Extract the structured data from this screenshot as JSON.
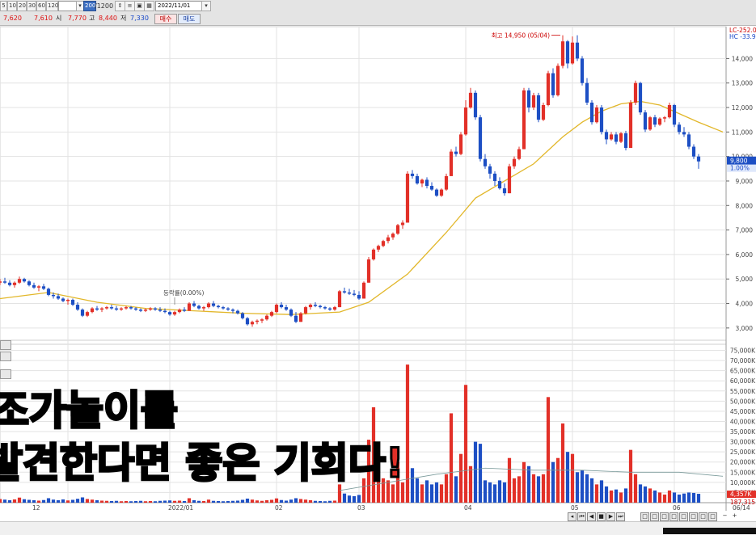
{
  "toolbar": {
    "periods": [
      "5",
      "10",
      "20",
      "30",
      "60",
      "120"
    ],
    "period_input": "",
    "count_selected": "200",
    "count_total": "/1200",
    "date": "2022/11/01"
  },
  "quote": {
    "current": "7,620",
    "change": "7,610",
    "open_label": "시",
    "open": "7,770",
    "high_label": "고",
    "high": "8,440",
    "low_label": "저",
    "low": "7,330",
    "buy_label": "매수",
    "sell_label": "매도"
  },
  "annotations": {
    "high_marker": "최고 14,950 (05/04)",
    "limit_marker": "등락률(0.00%)",
    "lc": "LC-252.0",
    "hc": "HC -33.9",
    "current_price_badge": "9,800",
    "current_pct_badge": "1.00%",
    "volume_badge": "4,357K",
    "volume_ma_badge": "187,315"
  },
  "date_labels": [
    "12",
    "2022/01",
    "02",
    "03",
    "04",
    "05",
    "06",
    "06/14"
  ],
  "overlay_text": {
    "line1_red": "조",
    "line1_white": "가놀이를",
    "line2_white": "발견한다면 ",
    "line2_red": "좋은 기회다!"
  },
  "colors": {
    "up": "#e23028",
    "down": "#1d4fc4",
    "ma": "#e2b72a",
    "grid": "#e3e3e3"
  },
  "chart_data": {
    "type": "candlestick",
    "price_axis": {
      "ticks": [
        3000,
        4000,
        5000,
        6000,
        7000,
        8000,
        9000,
        10000,
        11000,
        12000,
        13000,
        14000
      ],
      "tick_labels": [
        "3,000",
        "4,000",
        "5,000",
        "6,000",
        "7,000",
        "8,000",
        "9,000",
        "10,000",
        "11,000",
        "12,000",
        "13,000",
        "14,000"
      ],
      "ylim": [
        2500,
        15300
      ]
    },
    "volume_axis": {
      "ticks": [
        5000,
        10000,
        15000,
        20000,
        25000,
        30000,
        35000,
        40000,
        45000,
        50000,
        55000,
        60000,
        65000,
        70000,
        75000
      ],
      "tick_labels": [
        "5,000K",
        "10,000K",
        "15,000K",
        "20,000K",
        "25,000K",
        "30,000K",
        "35,000K",
        "40,000K",
        "45,000K",
        "50,000K",
        "55,000K",
        "60,000K",
        "65,000K",
        "70,000K",
        "75,000K"
      ],
      "ylim": [
        0,
        78000
      ]
    },
    "candles": [
      [
        4850,
        5000,
        4750,
        4900,
        1800
      ],
      [
        4900,
        5050,
        4800,
        4850,
        1500
      ],
      [
        4850,
        4950,
        4700,
        4750,
        1200
      ],
      [
        4750,
        4900,
        4650,
        4850,
        1600
      ],
      [
        4850,
        5100,
        4800,
        5000,
        2500
      ],
      [
        5000,
        5050,
        4850,
        4900,
        1700
      ],
      [
        4900,
        4950,
        4700,
        4750,
        1400
      ],
      [
        4750,
        4850,
        4600,
        4650,
        1200
      ],
      [
        4650,
        4750,
        4500,
        4700,
        1000
      ],
      [
        4700,
        4800,
        4550,
        4600,
        1300
      ],
      [
        4600,
        4650,
        4300,
        4350,
        2200
      ],
      [
        4350,
        4450,
        4200,
        4300,
        1500
      ],
      [
        4300,
        4400,
        4150,
        4200,
        1200
      ],
      [
        4200,
        4250,
        4050,
        4100,
        1600
      ],
      [
        4100,
        4200,
        3950,
        4150,
        1100
      ],
      [
        4150,
        4200,
        3900,
        3950,
        1400
      ],
      [
        3950,
        4050,
        3700,
        3750,
        1900
      ],
      [
        3750,
        3800,
        3450,
        3500,
        2600
      ],
      [
        3500,
        3700,
        3450,
        3650,
        1800
      ],
      [
        3650,
        3850,
        3600,
        3800,
        1500
      ],
      [
        3800,
        3900,
        3700,
        3750,
        1200
      ],
      [
        3750,
        3850,
        3650,
        3800,
        1000
      ],
      [
        3800,
        3900,
        3750,
        3850,
        900
      ],
      [
        3850,
        3950,
        3750,
        3800,
        800
      ],
      [
        3800,
        3900,
        3700,
        3750,
        900
      ],
      [
        3750,
        3850,
        3700,
        3800,
        700
      ],
      [
        3800,
        3900,
        3750,
        3850,
        800
      ],
      [
        3850,
        3900,
        3750,
        3800,
        700
      ],
      [
        3800,
        3850,
        3700,
        3750,
        800
      ],
      [
        3750,
        3800,
        3650,
        3700,
        900
      ],
      [
        3700,
        3800,
        3650,
        3750,
        700
      ],
      [
        3750,
        3850,
        3700,
        3800,
        800
      ],
      [
        3800,
        3850,
        3700,
        3750,
        700
      ],
      [
        3750,
        3850,
        3650,
        3700,
        900
      ],
      [
        3700,
        3800,
        3600,
        3650,
        1000
      ],
      [
        3650,
        3700,
        3500,
        3550,
        1100
      ],
      [
        3550,
        3700,
        3500,
        3650,
        900
      ],
      [
        3650,
        3800,
        3600,
        3750,
        1000
      ],
      [
        3750,
        3850,
        3650,
        3700,
        800
      ],
      [
        3700,
        4050,
        3700,
        4000,
        2200
      ],
      [
        4000,
        4100,
        3850,
        3900,
        1200
      ],
      [
        3900,
        3950,
        3750,
        3800,
        900
      ],
      [
        3800,
        3900,
        3700,
        3850,
        800
      ],
      [
        3850,
        4050,
        3800,
        4000,
        1500
      ],
      [
        4000,
        4100,
        3850,
        3900,
        900
      ],
      [
        3900,
        3950,
        3800,
        3850,
        800
      ],
      [
        3850,
        3900,
        3750,
        3800,
        700
      ],
      [
        3800,
        3850,
        3700,
        3750,
        800
      ],
      [
        3750,
        3800,
        3600,
        3700,
        900
      ],
      [
        3700,
        3750,
        3550,
        3600,
        1000
      ],
      [
        3600,
        3650,
        3350,
        3400,
        1400
      ],
      [
        3400,
        3450,
        3100,
        3150,
        2000
      ],
      [
        3150,
        3300,
        3050,
        3250,
        1500
      ],
      [
        3250,
        3350,
        3150,
        3300,
        1100
      ],
      [
        3300,
        3400,
        3200,
        3350,
        900
      ],
      [
        3350,
        3550,
        3300,
        3500,
        1200
      ],
      [
        3500,
        3700,
        3450,
        3650,
        1400
      ],
      [
        3650,
        4000,
        3600,
        3950,
        2100
      ],
      [
        3950,
        4050,
        3800,
        3850,
        1300
      ],
      [
        3850,
        3950,
        3700,
        3750,
        1000
      ],
      [
        3750,
        3800,
        3450,
        3500,
        1500
      ],
      [
        3500,
        3650,
        3200,
        3250,
        2200
      ],
      [
        3250,
        3650,
        3250,
        3600,
        1800
      ],
      [
        3600,
        3900,
        3550,
        3850,
        1500
      ],
      [
        3850,
        4000,
        3750,
        3950,
        1200
      ],
      [
        3950,
        4050,
        3850,
        3900,
        900
      ],
      [
        3900,
        3950,
        3800,
        3850,
        800
      ],
      [
        3850,
        3900,
        3750,
        3800,
        700
      ],
      [
        3800,
        3850,
        3700,
        3750,
        900
      ],
      [
        3750,
        3900,
        3700,
        3850,
        1000
      ],
      [
        3850,
        4550,
        3850,
        4500,
        9000
      ],
      [
        4500,
        4650,
        4400,
        4450,
        4500
      ],
      [
        4450,
        4600,
        4350,
        4400,
        3500
      ],
      [
        4400,
        4550,
        4300,
        4350,
        3200
      ],
      [
        4350,
        4500,
        4150,
        4200,
        3800
      ],
      [
        4200,
        4900,
        4200,
        4850,
        12000
      ],
      [
        4850,
        5900,
        4850,
        5800,
        31000
      ],
      [
        5800,
        6250,
        5750,
        6200,
        47000
      ],
      [
        6200,
        6400,
        6100,
        6350,
        11000
      ],
      [
        6350,
        6600,
        6300,
        6550,
        12000
      ],
      [
        6550,
        6800,
        6450,
        6700,
        11000
      ],
      [
        6700,
        6900,
        6600,
        6850,
        9000
      ],
      [
        6850,
        7250,
        6800,
        7200,
        20000
      ],
      [
        7200,
        7400,
        7050,
        7300,
        10000
      ],
      [
        7300,
        9400,
        7300,
        9300,
        68000
      ],
      [
        9300,
        9450,
        9100,
        9200,
        17000
      ],
      [
        9200,
        9300,
        8850,
        8900,
        12000
      ],
      [
        8900,
        9100,
        8750,
        9050,
        9000
      ],
      [
        9050,
        9150,
        8700,
        8800,
        11000
      ],
      [
        8800,
        8950,
        8600,
        8650,
        9000
      ],
      [
        8650,
        8700,
        8350,
        8400,
        10000
      ],
      [
        8400,
        8700,
        8350,
        8650,
        9000
      ],
      [
        8650,
        9300,
        8600,
        9200,
        14000
      ],
      [
        9200,
        10300,
        9200,
        10200,
        44000
      ],
      [
        10200,
        10400,
        10000,
        10100,
        13000
      ],
      [
        10100,
        11000,
        10050,
        10900,
        24000
      ],
      [
        10900,
        12300,
        10850,
        12000,
        58000
      ],
      [
        12000,
        12800,
        11950,
        12600,
        18000
      ],
      [
        12600,
        12700,
        11500,
        11600,
        30000
      ],
      [
        11600,
        11700,
        9800,
        9900,
        29000
      ],
      [
        9900,
        10100,
        9500,
        9600,
        11000
      ],
      [
        9600,
        9700,
        9100,
        9300,
        10000
      ],
      [
        9300,
        9400,
        8800,
        9000,
        9000
      ],
      [
        9000,
        9150,
        8650,
        8700,
        11000
      ],
      [
        8700,
        8900,
        8400,
        8500,
        10000
      ],
      [
        8500,
        9700,
        8500,
        9600,
        22000
      ],
      [
        9600,
        10000,
        9500,
        9900,
        12000
      ],
      [
        9900,
        10400,
        9850,
        10300,
        13000
      ],
      [
        10300,
        12800,
        10300,
        12700,
        20000
      ],
      [
        12700,
        12800,
        11800,
        12000,
        18000
      ],
      [
        12000,
        12600,
        11900,
        12500,
        14000
      ],
      [
        12500,
        12600,
        11400,
        11500,
        13000
      ],
      [
        11500,
        12200,
        11450,
        12100,
        14000
      ],
      [
        12100,
        13500,
        12050,
        13400,
        52000
      ],
      [
        13400,
        13600,
        12400,
        12500,
        20000
      ],
      [
        12500,
        13800,
        12450,
        13700,
        22000
      ],
      [
        13700,
        14950,
        13600,
        14700,
        39000
      ],
      [
        14700,
        14750,
        13600,
        13800,
        25000
      ],
      [
        13800,
        14900,
        13750,
        14650,
        24000
      ],
      [
        14650,
        14950,
        13900,
        14000,
        15000
      ],
      [
        14000,
        14100,
        12900,
        13000,
        16000
      ],
      [
        13000,
        13200,
        12100,
        12200,
        14000
      ],
      [
        12200,
        12300,
        11300,
        11400,
        12000
      ],
      [
        11400,
        12100,
        11350,
        12000,
        9000
      ],
      [
        12000,
        12100,
        10900,
        11000,
        11000
      ],
      [
        11000,
        11100,
        10500,
        10700,
        8000
      ],
      [
        10700,
        11000,
        10650,
        10900,
        6000
      ],
      [
        10900,
        11000,
        10500,
        10600,
        6500
      ],
      [
        10600,
        11000,
        10550,
        10950,
        5000
      ],
      [
        10950,
        11050,
        10250,
        10350,
        7000
      ],
      [
        10350,
        12300,
        10350,
        12200,
        26000
      ],
      [
        12200,
        13100,
        12100,
        13000,
        14000
      ],
      [
        13000,
        13050,
        11700,
        11800,
        9000
      ],
      [
        11800,
        11900,
        11000,
        11100,
        8000
      ],
      [
        11100,
        11650,
        11050,
        11600,
        7000
      ],
      [
        11600,
        11700,
        11200,
        11300,
        6000
      ],
      [
        11300,
        11600,
        11250,
        11550,
        5000
      ],
      [
        11550,
        11650,
        11400,
        11600,
        4000
      ],
      [
        11600,
        12200,
        11550,
        12100,
        6000
      ],
      [
        12100,
        12150,
        11200,
        11300,
        5000
      ],
      [
        11300,
        11400,
        10900,
        11000,
        4000
      ],
      [
        11000,
        11200,
        10800,
        10900,
        4500
      ],
      [
        10900,
        11000,
        10300,
        10400,
        5000
      ],
      [
        10400,
        10500,
        9900,
        10000,
        4800
      ],
      [
        10000,
        10100,
        9500,
        9800,
        4357
      ]
    ],
    "ma20_points": [
      [
        0,
        4200
      ],
      [
        10,
        4450
      ],
      [
        20,
        4050
      ],
      [
        30,
        3800
      ],
      [
        40,
        3700
      ],
      [
        50,
        3600
      ],
      [
        60,
        3550
      ],
      [
        70,
        3650
      ],
      [
        76,
        4050
      ],
      [
        84,
        5200
      ],
      [
        92,
        6900
      ],
      [
        98,
        8300
      ],
      [
        104,
        9000
      ],
      [
        110,
        9700
      ],
      [
        116,
        10800
      ],
      [
        120,
        11400
      ],
      [
        124,
        11850
      ],
      [
        128,
        12150
      ],
      [
        132,
        12250
      ],
      [
        136,
        12100
      ],
      [
        140,
        11750
      ],
      [
        144,
        11400
      ],
      [
        149,
        11000
      ]
    ],
    "volume_ma_points": [
      [
        70,
        6000
      ],
      [
        80,
        10000
      ],
      [
        90,
        14000
      ],
      [
        100,
        17000
      ],
      [
        110,
        16000
      ],
      [
        120,
        16000
      ],
      [
        130,
        15000
      ],
      [
        140,
        15000
      ],
      [
        149,
        13000
      ]
    ]
  }
}
